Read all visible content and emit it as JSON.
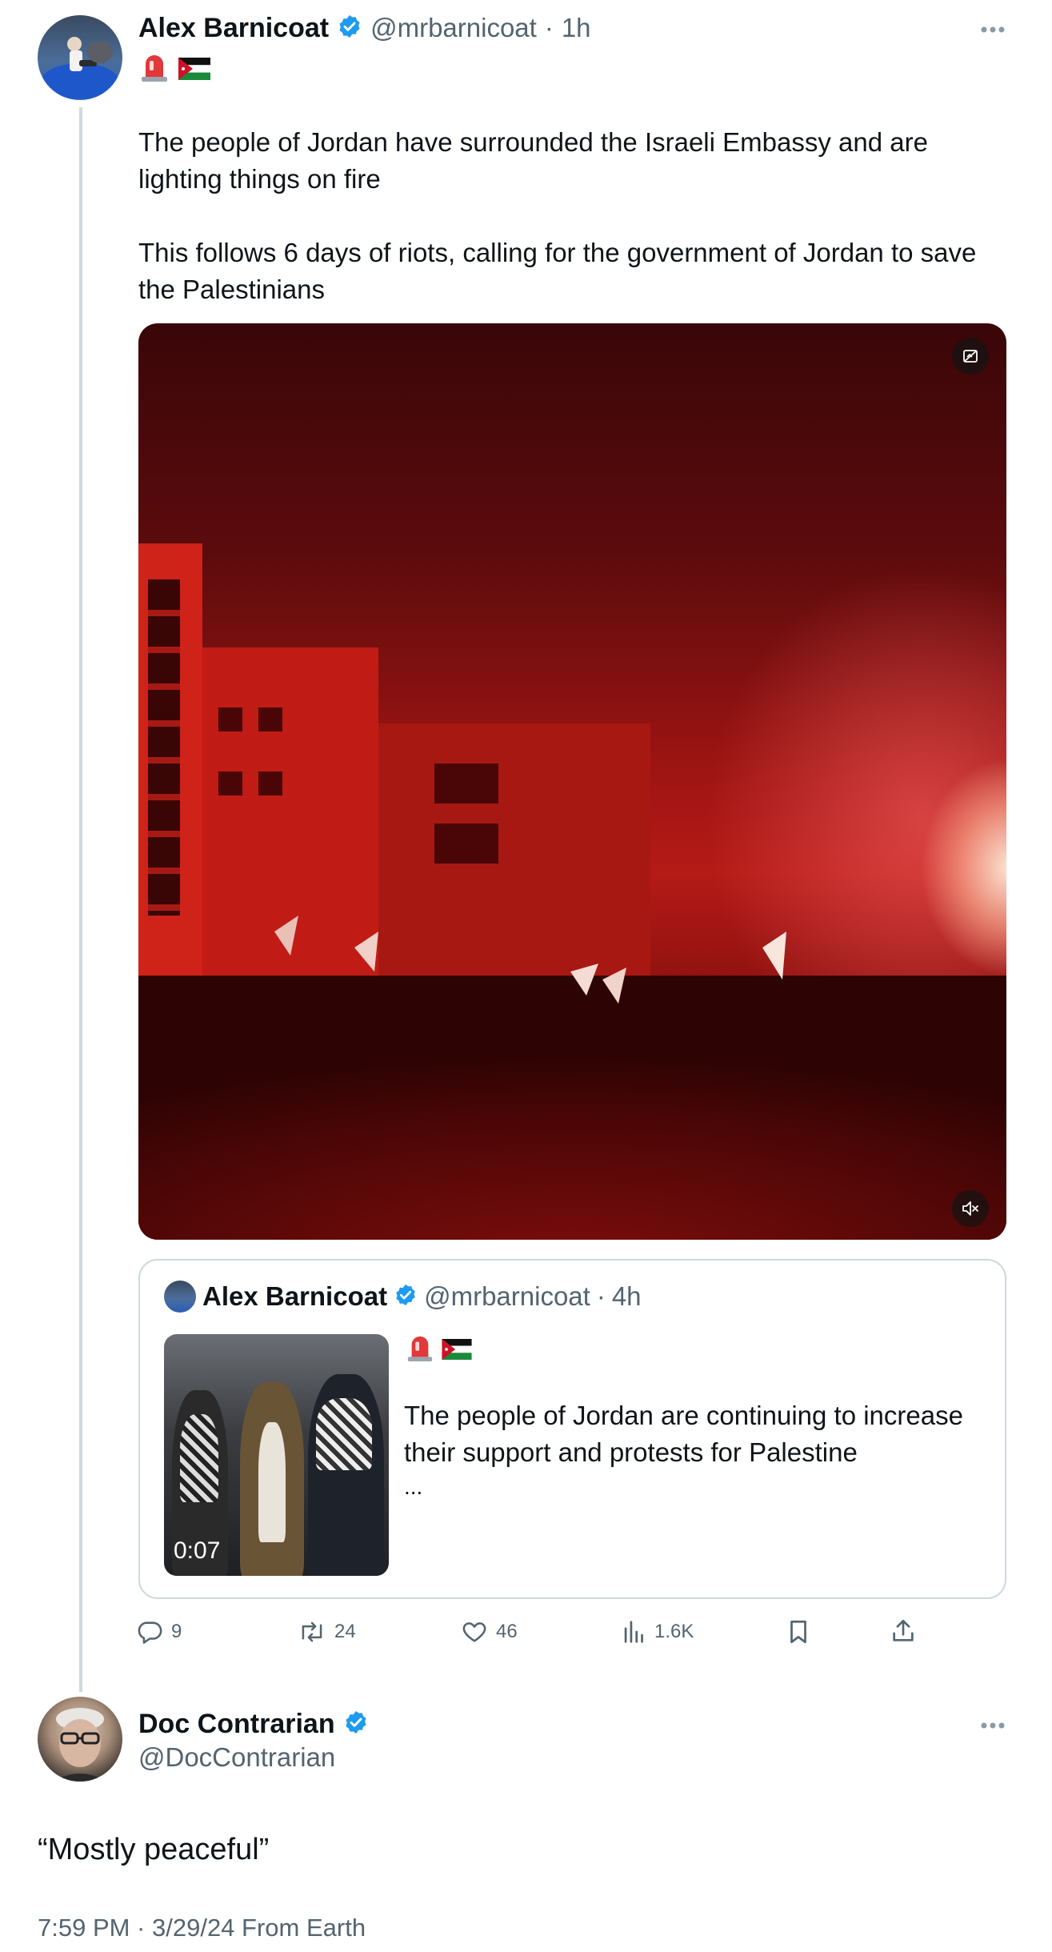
{
  "main_tweet": {
    "author_name": "Alex Barnicoat",
    "handle": "@mrbarnicoat",
    "separator": "·",
    "time": "1h",
    "emoji_icons": [
      "siren-icon",
      "jordan-flag-icon"
    ],
    "text_line1": "The people of Jordan have surrounded the Israeli Embassy and are",
    "text_line2": "lighting things on fire",
    "text_line3": "This follows 6 days of riots, calling for the government of Jordan to save",
    "text_line4": "the Palestinians",
    "more_icon": "more-dots-icon"
  },
  "quoted_tweet": {
    "author_name": "Alex Barnicoat",
    "handle": "@mrbarnicoat",
    "separator": "·",
    "time": "4h",
    "emoji_icons": [
      "siren-icon",
      "jordan-flag-icon"
    ],
    "text_line1": "The people of Jordan are continuing to increase",
    "text_line2": "their support and protests for Palestine",
    "ellipsis": "...",
    "video_duration": "0:07"
  },
  "actions": {
    "replies": "9",
    "retweets": "24",
    "likes": "46",
    "views": "1.6K"
  },
  "reply_tweet": {
    "author_name": "Doc Contrarian",
    "handle": "@DocContrarian",
    "text": "“Mostly peaceful”",
    "timestamp": "7:59 PM · 3/29/24 From Earth"
  },
  "colors": {
    "verified": "#1d9bf0",
    "text": "#0f1419",
    "muted": "#536471",
    "border": "#cfd9de"
  }
}
